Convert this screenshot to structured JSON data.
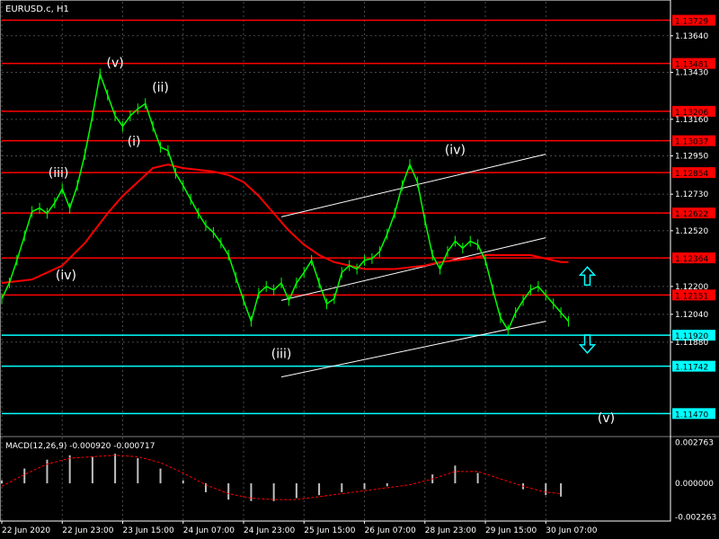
{
  "chart_data": {
    "type": "line",
    "title": "EURUSD.c, H1",
    "price_scale": {
      "ticks": [
        "1.13640",
        "1.13430",
        "1.13160",
        "1.12950",
        "1.12730",
        "1.12520",
        "1.12200",
        "1.12040",
        "1.11880"
      ],
      "tick_values": [
        1.1364,
        1.1343,
        1.1316,
        1.1295,
        1.1273,
        1.1252,
        1.122,
        1.1204,
        1.1188
      ]
    },
    "time_axis": {
      "labels": [
        "22 Jun 2020",
        "22 Jun 23:00",
        "23 Jun 15:00",
        "24 Jun 07:00",
        "24 Jun 23:00",
        "25 Jun 15:00",
        "26 Jun 07:00",
        "28 Jun 23:00",
        "29 Jun 15:00",
        "30 Jun 07:00"
      ],
      "label_index": [
        0,
        16,
        32,
        48,
        64,
        80,
        96,
        112,
        128,
        144
      ]
    },
    "levels": [
      {
        "label": "1.13729",
        "value": 1.13729,
        "color": "#ff0000"
      },
      {
        "label": "1.13481",
        "value": 1.13481,
        "color": "#ff0000"
      },
      {
        "label": "1.13206",
        "value": 1.13206,
        "color": "#ff0000"
      },
      {
        "label": "1.13037",
        "value": 1.13037,
        "color": "#ff0000"
      },
      {
        "label": "1.12854",
        "value": 1.12854,
        "color": "#ff0000"
      },
      {
        "label": "1.12622",
        "value": 1.12622,
        "color": "#ff0000"
      },
      {
        "label": "1.12364",
        "value": 1.12364,
        "color": "#ff0000"
      },
      {
        "label": "1.12151",
        "value": 1.12151,
        "color": "#ff0000"
      },
      {
        "label": "1.11920",
        "value": 1.1192,
        "color": "#00ffff"
      },
      {
        "label": "1.11742",
        "value": 1.11742,
        "color": "#00ffff"
      },
      {
        "label": "1.11470",
        "value": 1.1147,
        "color": "#00ffff"
      }
    ],
    "price_series": {
      "name": "",
      "color": "#00ff00",
      "x": [
        0,
        2,
        4,
        6,
        8,
        10,
        12,
        14,
        16,
        18,
        20,
        22,
        24,
        26,
        28,
        30,
        32,
        34,
        36,
        38,
        40,
        42,
        44,
        46,
        48,
        50,
        52,
        54,
        56,
        58,
        60,
        62,
        64,
        66,
        68,
        70,
        72,
        74,
        76,
        78,
        80,
        82,
        84,
        86,
        88,
        90,
        92,
        94,
        96,
        98,
        100,
        102,
        104,
        106,
        108,
        110,
        112,
        114,
        116,
        118,
        120,
        122,
        124,
        126,
        128,
        130,
        132,
        134,
        136,
        138,
        140,
        142,
        144,
        146,
        148,
        150
      ],
      "y": [
        1.1213,
        1.1222,
        1.1235,
        1.1249,
        1.1263,
        1.1265,
        1.1262,
        1.1268,
        1.1276,
        1.1265,
        1.1278,
        1.1296,
        1.1318,
        1.1342,
        1.133,
        1.1318,
        1.1312,
        1.1318,
        1.1322,
        1.1325,
        1.1312,
        1.13,
        1.1298,
        1.1285,
        1.1278,
        1.127,
        1.1262,
        1.1255,
        1.1251,
        1.1245,
        1.1238,
        1.1225,
        1.1212,
        1.12,
        1.1216,
        1.122,
        1.1218,
        1.1222,
        1.1212,
        1.1222,
        1.1228,
        1.1235,
        1.1222,
        1.121,
        1.1213,
        1.1228,
        1.1232,
        1.123,
        1.1235,
        1.1236,
        1.124,
        1.125,
        1.1262,
        1.1278,
        1.129,
        1.128,
        1.1258,
        1.1238,
        1.123,
        1.124,
        1.1246,
        1.1242,
        1.1246,
        1.1244,
        1.1235,
        1.1218,
        1.1202,
        1.1195,
        1.1205,
        1.1212,
        1.1218,
        1.122,
        1.1215,
        1.121,
        1.1205,
        1.12
      ]
    },
    "moving_average": {
      "name": "",
      "color": "#ff0000",
      "x": [
        0,
        8,
        16,
        22,
        28,
        32,
        36,
        40,
        44,
        48,
        52,
        56,
        60,
        64,
        68,
        72,
        76,
        80,
        84,
        88,
        92,
        96,
        100,
        104,
        108,
        112,
        116,
        120,
        124,
        128,
        132,
        136,
        140,
        144,
        148,
        150
      ],
      "y": [
        1.1222,
        1.1224,
        1.1232,
        1.1245,
        1.1262,
        1.1272,
        1.128,
        1.1288,
        1.129,
        1.1288,
        1.1287,
        1.1286,
        1.1284,
        1.128,
        1.1272,
        1.1262,
        1.1252,
        1.1244,
        1.1238,
        1.1234,
        1.1232,
        1.123,
        1.123,
        1.123,
        1.1231,
        1.1232,
        1.1234,
        1.1235,
        1.1236,
        1.1238,
        1.1238,
        1.1238,
        1.1238,
        1.1236,
        1.1234,
        1.1234
      ]
    },
    "trend_lines": [
      {
        "x1": 74,
        "y1": 1.126,
        "x2": 144,
        "y2": 1.1296,
        "color": "#ffffff"
      },
      {
        "x1": 74,
        "y1": 1.1212,
        "x2": 144,
        "y2": 1.1248,
        "color": "#ffffff"
      },
      {
        "x1": 74,
        "y1": 1.1168,
        "x2": 144,
        "y2": 1.12,
        "color": "#ffffff"
      }
    ],
    "wave_labels": [
      {
        "text": "(v)",
        "x": 30,
        "y": 1.1346
      },
      {
        "text": "(ii)",
        "x": 42,
        "y": 1.1332
      },
      {
        "text": "(i)",
        "x": 35,
        "y": 1.1301
      },
      {
        "text": "(iii)",
        "x": 15,
        "y": 1.1283
      },
      {
        "text": "(iv)",
        "x": 17,
        "y": 1.1224
      },
      {
        "text": "(iii)",
        "x": 74,
        "y": 1.1179
      },
      {
        "text": "(iv)",
        "x": 120,
        "y": 1.1296
      },
      {
        "text": "(v)",
        "x": 160,
        "y": 1.1142
      }
    ],
    "arrows": [
      {
        "direction": "up",
        "x": 155,
        "y": 1.1226,
        "color": "#00ffff"
      },
      {
        "direction": "down",
        "x": 155,
        "y": 1.1187,
        "color": "#00ffff"
      }
    ],
    "x_range": [
      0,
      177
    ],
    "y_range": [
      1.11348,
      1.13835
    ],
    "macd": {
      "label": "MACD(12,26,9) -0.000920 -0.000717",
      "y_ticks": [
        "0.002763",
        "0.000000",
        "-0.002263"
      ],
      "y_tick_values": [
        0.002763,
        0,
        -0.002263
      ],
      "y_range": [
        -0.00255,
        0.0031
      ],
      "histogram_color": "#c0c0c0",
      "signal_color": "#ff0000",
      "x": [
        0,
        6,
        12,
        18,
        24,
        30,
        36,
        42,
        48,
        54,
        60,
        66,
        72,
        78,
        84,
        90,
        96,
        102,
        108,
        114,
        120,
        126,
        132,
        138,
        144,
        148
      ],
      "hist": [
        0.0002,
        0.001,
        0.0016,
        0.0019,
        0.0018,
        0.002,
        0.0017,
        0.001,
        0.0002,
        -0.0006,
        -0.0011,
        -0.0012,
        -0.0012,
        -0.001,
        -0.0008,
        -0.0006,
        -0.0004,
        -0.0002,
        0.0,
        0.0006,
        0.0012,
        0.0007,
        0.0,
        -0.0004,
        -0.0008,
        -0.0009
      ],
      "signal": [
        -0.0002,
        0.0006,
        0.0013,
        0.0017,
        0.0018,
        0.0019,
        0.0018,
        0.0014,
        0.0007,
        -0.0001,
        -0.0007,
        -0.001,
        -0.0011,
        -0.0011,
        -0.0009,
        -0.0007,
        -0.0005,
        -0.0003,
        -0.0001,
        0.0003,
        0.0008,
        0.0008,
        0.0003,
        -0.0002,
        -0.0006,
        -0.0007
      ]
    }
  }
}
